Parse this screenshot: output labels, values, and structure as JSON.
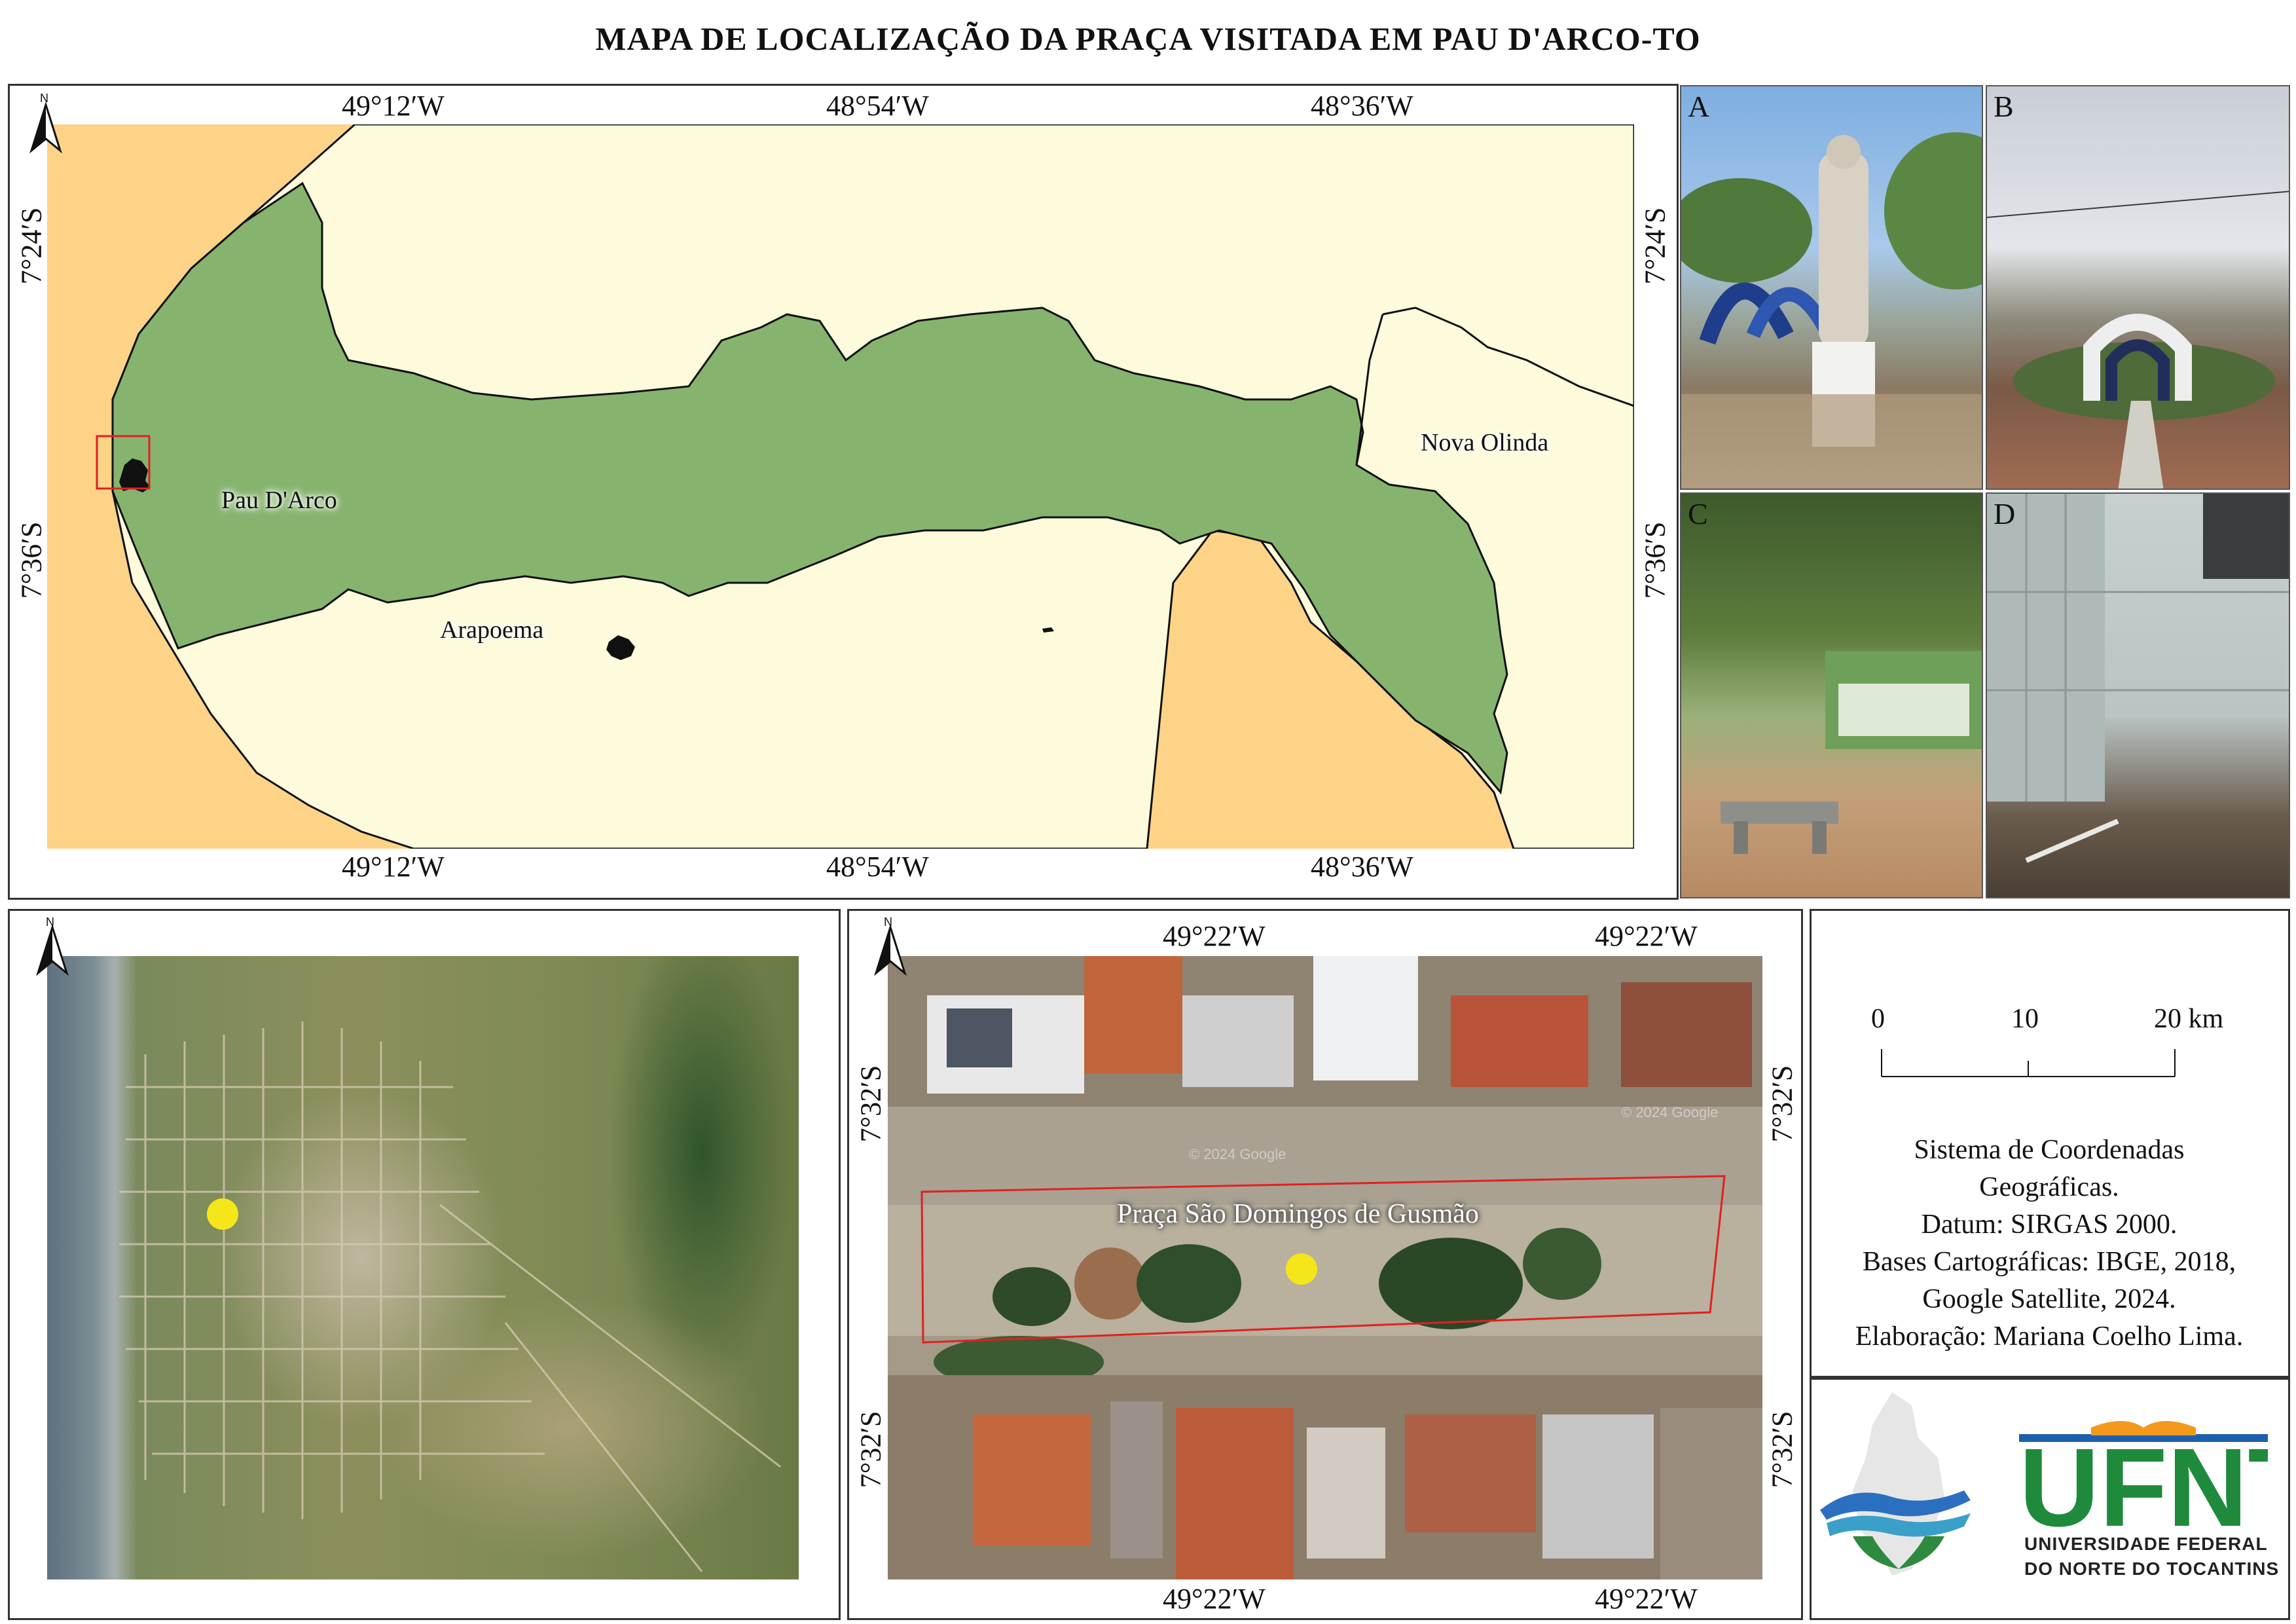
{
  "title": "MAPA DE LOCALIZAÇÃO DA PRAÇA VISITADA EM PAU D'ARCO-TO",
  "main_map": {
    "lon_top": [
      "49°12′W",
      "48°54′W",
      "48°36′W"
    ],
    "lon_bottom": [
      "49°12′W",
      "48°54′W",
      "48°36′W"
    ],
    "lat_left": [
      "7°24′S",
      "7°36′S"
    ],
    "lat_right": [
      "7°24′S",
      "7°36′S"
    ],
    "places": {
      "pau_darco": "Pau D'Arco",
      "arapoema": "Arapoema",
      "nova_olinda": "Nova Olinda"
    },
    "colors": {
      "pau_darco": "#86b46e",
      "neighbors": "#fefbdc",
      "state_outside": "#fdd387",
      "highlight": "#e02020"
    }
  },
  "photos": {
    "a": "A",
    "b": "B",
    "c": "C",
    "d": "D"
  },
  "city_map": {
    "north": "N",
    "marker_color": "#f5e61a"
  },
  "plaza_map": {
    "north": "N",
    "lon_top": [
      "49°22′W",
      "49°22′W"
    ],
    "lon_bottom": [
      "49°22′W",
      "49°22′W"
    ],
    "lat_left": [
      "7°32′S",
      "7°32′S"
    ],
    "lat_right": [
      "7°32′S",
      "7°32′S"
    ],
    "plaza_label": "Praça São Domingos de Gusmão",
    "watermark": "© 2024 Google"
  },
  "main_north": "N",
  "scale_bar": {
    "ticks": [
      "0",
      "10",
      "20 km"
    ]
  },
  "legend": {
    "lines": [
      "Sistema de Coordenadas",
      "Geográficas.",
      "Datum: SIRGAS 2000.",
      "Bases Cartográficas: IBGE, 2018,",
      "Google Satellite, 2024.",
      "Elaboração: Mariana Coelho Lima."
    ]
  },
  "logos": {
    "ufnt_name": "UFNT",
    "ufnt_sub1": "UNIVERSIDADE FEDERAL",
    "ufnt_sub2": "DO NORTE DO TOCANTINS",
    "ufnt_green": "#1f8a3c",
    "ufnt_blue": "#1d5fae",
    "ufnt_orange": "#f39a1e"
  }
}
